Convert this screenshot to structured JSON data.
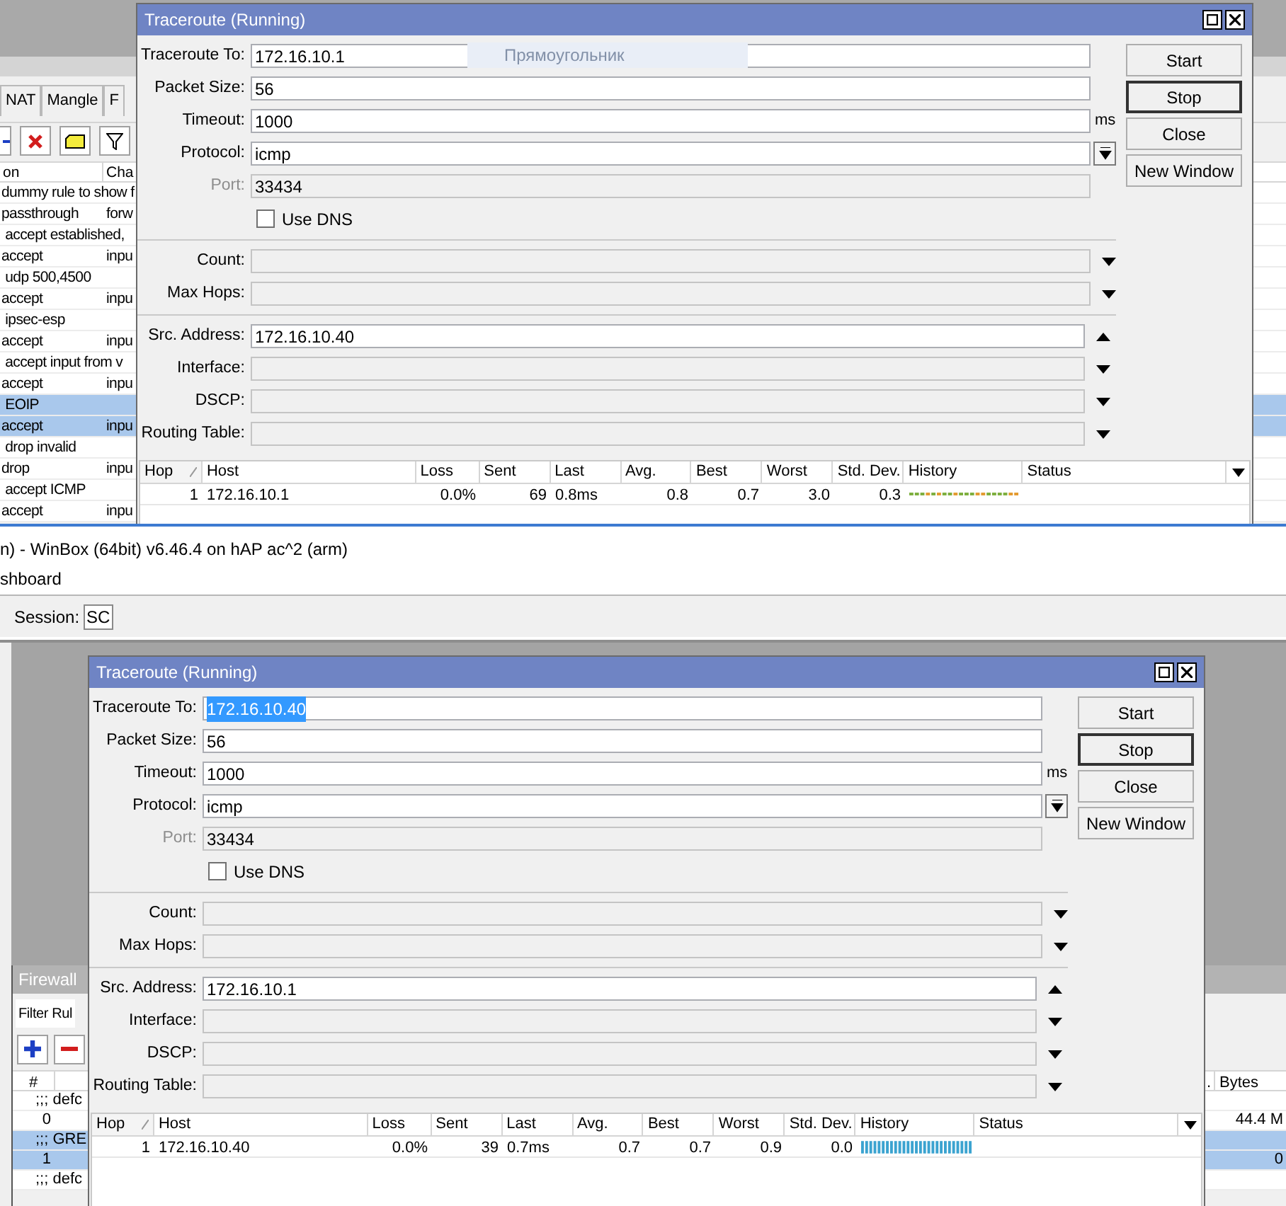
{
  "top_screen": {
    "firewall": {
      "tabs": [
        {
          "label": "NAT",
          "selected": false
        },
        {
          "label": "Mangle",
          "selected": false
        },
        {
          "label": "F",
          "selected": false
        }
      ],
      "columns": [
        "on",
        "Cha"
      ],
      "rows": [
        {
          "kind": "comment",
          "text": "dummy rule to show f",
          "selected": false
        },
        {
          "kind": "rule",
          "action": "passthrough",
          "chain": "forw",
          "selected": false
        },
        {
          "kind": "comment",
          "text": " accept established,",
          "selected": false
        },
        {
          "kind": "rule",
          "action": "accept",
          "chain": "inpu",
          "selected": false
        },
        {
          "kind": "comment",
          "text": " udp 500,4500",
          "selected": false
        },
        {
          "kind": "rule",
          "action": "accept",
          "chain": "inpu",
          "selected": false
        },
        {
          "kind": "comment",
          "text": " ipsec-esp",
          "selected": false
        },
        {
          "kind": "rule",
          "action": "accept",
          "chain": "inpu",
          "selected": false
        },
        {
          "kind": "comment",
          "text": " accept input from v",
          "selected": false
        },
        {
          "kind": "rule",
          "action": "accept",
          "chain": "inpu",
          "selected": false
        },
        {
          "kind": "comment",
          "text": " EOIP",
          "selected": true
        },
        {
          "kind": "rule",
          "action": "accept",
          "chain": "inpu",
          "selected": true
        },
        {
          "kind": "comment",
          "text": " drop invalid",
          "selected": false
        },
        {
          "kind": "rule",
          "action": "drop",
          "chain": "inpu",
          "selected": false
        },
        {
          "kind": "comment",
          "text": " accept ICMP",
          "selected": false
        },
        {
          "kind": "rule",
          "action": "accept",
          "chain": "inpu",
          "selected": false
        }
      ]
    },
    "ghost_label": "Прямоугольник",
    "traceroute": {
      "title": "Traceroute (Running)",
      "sections": [
        [
          {
            "kind": "text",
            "label": "Traceroute To:",
            "value": "172.16.10.1",
            "disabled": false,
            "text_selected": false
          },
          {
            "kind": "text",
            "label": "Packet Size:",
            "value": "56",
            "disabled": false
          },
          {
            "kind": "unit",
            "label": "Timeout:",
            "value": "1000",
            "unit": "ms",
            "disabled": false
          },
          {
            "kind": "select",
            "label": "Protocol:",
            "value": "icmp",
            "disabled": false
          },
          {
            "kind": "text",
            "label": "Port:",
            "value": "33434",
            "disabled": true
          },
          {
            "kind": "checkbox",
            "label": "Use DNS",
            "checked": false
          }
        ],
        [
          {
            "kind": "expand",
            "label": "Count:",
            "disabled": false
          },
          {
            "kind": "expand",
            "label": "Max Hops:",
            "disabled": false
          }
        ],
        [
          {
            "kind": "collapse",
            "label": "Src. Address:",
            "value": "172.16.10.40",
            "disabled": false
          },
          {
            "kind": "expand",
            "label": "Interface:",
            "disabled": false
          },
          {
            "kind": "expand",
            "label": "DSCP:",
            "disabled": false
          },
          {
            "kind": "expand",
            "label": "Routing Table:",
            "disabled": false
          }
        ]
      ],
      "buttons": [
        {
          "label": "Start",
          "focused": false
        },
        {
          "label": "Stop",
          "focused": true
        },
        {
          "label": "Close",
          "focused": false
        },
        {
          "label": "New Window",
          "focused": false
        }
      ],
      "columns": [
        {
          "label": "Hop",
          "sorted": true
        },
        {
          "label": "Host",
          "sorted": false
        },
        {
          "label": "Loss",
          "sorted": false
        },
        {
          "label": "Sent",
          "sorted": false
        },
        {
          "label": "Last",
          "sorted": false
        },
        {
          "label": "Avg.",
          "sorted": false
        },
        {
          "label": "Best",
          "sorted": false
        },
        {
          "label": "Worst",
          "sorted": false
        },
        {
          "label": "Std. Dev.",
          "sorted": false
        },
        {
          "label": "History",
          "sorted": false
        },
        {
          "label": "Status",
          "sorted": false
        }
      ],
      "rows": [
        {
          "cells": [
            "1",
            "172.16.10.1",
            "0.0%",
            "69",
            "0.8ms",
            "0.8",
            "0.7",
            "3.0",
            "0.3"
          ],
          "kind": "dots"
        }
      ]
    }
  },
  "winbox": {
    "title": "n) - WinBox (64bit) v6.46.4 on hAP ac^2 (arm)",
    "menu_item": "shboard",
    "session_label": "Session:",
    "session_value": "SC"
  },
  "bottom_screen": {
    "firewall": {
      "title": "Firewall",
      "tabs": [
        {
          "label": "Filter Rul",
          "selected": true
        }
      ],
      "columns": [
        "#",
        ".",
        "Bytes"
      ],
      "rows": [
        {
          "kind": "comment",
          "text": ";;; defc",
          "selected": false
        },
        {
          "kind": "rule",
          "number": "0",
          "bytes": "44.4 M",
          "selected": false
        },
        {
          "kind": "comment",
          "text": ";;; GRE",
          "selected": true
        },
        {
          "kind": "rule",
          "number": "1",
          "bytes": "0",
          "selected": true
        },
        {
          "kind": "comment",
          "text": ";;; defc",
          "selected": false
        }
      ]
    },
    "traceroute": {
      "title": "Traceroute (Running)",
      "sections": [
        [
          {
            "kind": "text",
            "label": "Traceroute To:",
            "value": "172.16.10.40",
            "disabled": false,
            "text_selected": true
          },
          {
            "kind": "text",
            "label": "Packet Size:",
            "value": "56",
            "disabled": false
          },
          {
            "kind": "unit",
            "label": "Timeout:",
            "value": "1000",
            "unit": "ms",
            "disabled": false
          },
          {
            "kind": "select",
            "label": "Protocol:",
            "value": "icmp",
            "disabled": false
          },
          {
            "kind": "text",
            "label": "Port:",
            "value": "33434",
            "disabled": true
          },
          {
            "kind": "checkbox",
            "label": "Use DNS",
            "checked": false
          }
        ],
        [
          {
            "kind": "expand",
            "label": "Count:",
            "disabled": false
          },
          {
            "kind": "expand",
            "label": "Max Hops:",
            "disabled": false
          }
        ],
        [
          {
            "kind": "collapse",
            "label": "Src. Address:",
            "value": "172.16.10.1",
            "disabled": false
          },
          {
            "kind": "expand",
            "label": "Interface:",
            "disabled": false
          },
          {
            "kind": "expand",
            "label": "DSCP:",
            "disabled": false
          },
          {
            "kind": "expand",
            "label": "Routing Table:",
            "disabled": false
          }
        ]
      ],
      "buttons": [
        {
          "label": "Start",
          "focused": false
        },
        {
          "label": "Stop",
          "focused": true
        },
        {
          "label": "Close",
          "focused": false
        },
        {
          "label": "New Window",
          "focused": false
        }
      ],
      "columns": [
        {
          "label": "Hop",
          "sorted": true
        },
        {
          "label": "Host",
          "sorted": false
        },
        {
          "label": "Loss",
          "sorted": false
        },
        {
          "label": "Sent",
          "sorted": false
        },
        {
          "label": "Last",
          "sorted": false
        },
        {
          "label": "Avg.",
          "sorted": false
        },
        {
          "label": "Best",
          "sorted": false
        },
        {
          "label": "Worst",
          "sorted": false
        },
        {
          "label": "Std. Dev.",
          "sorted": false
        },
        {
          "label": "History",
          "sorted": false
        },
        {
          "label": "Status",
          "sorted": false
        }
      ],
      "rows": [
        {
          "cells": [
            "1",
            "172.16.10.40",
            "0.0%",
            "39",
            "0.7ms",
            "0.7",
            "0.7",
            "0.9",
            "0.0"
          ],
          "kind": "bars"
        }
      ]
    }
  }
}
